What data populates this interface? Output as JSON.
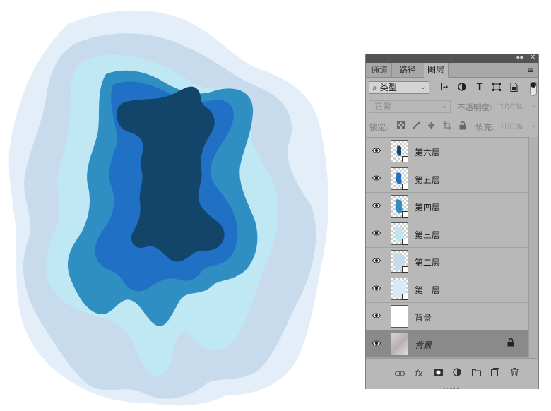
{
  "panel": {
    "collapse_glyph": "◂◂",
    "close_glyph": "✕",
    "tabs": [
      {
        "label": "通道",
        "active": false
      },
      {
        "label": "路径",
        "active": false
      },
      {
        "label": "图层",
        "active": true
      }
    ],
    "menu_glyph": "≡",
    "filter": {
      "label": "类型",
      "icons": [
        "image-filter-icon",
        "adjustment-filter-icon",
        "type-filter-icon",
        "shape-filter-icon",
        "smart-object-filter-icon"
      ]
    },
    "blend_mode": "正常",
    "opacity_label": "不透明度:",
    "opacity_value": "100%",
    "lock_label": "锁定:",
    "fill_label": "填充:",
    "fill_value": "100%",
    "layers": [
      {
        "name": "第六层",
        "thumb_color": "#16456b"
      },
      {
        "name": "第五层",
        "thumb_color": "#1f6fc4"
      },
      {
        "name": "第四层",
        "thumb_color": "#2f8dc0"
      },
      {
        "name": "第三层",
        "thumb_color": "#bfe6f3"
      },
      {
        "name": "第二层",
        "thumb_color": "#c7daea"
      },
      {
        "name": "第一层",
        "thumb_color": "#d9e9f5"
      },
      {
        "name": "背景",
        "thumb_color": "#ffffff"
      },
      {
        "name": "背景",
        "thumb_color": "#c9bcc3",
        "selected": true,
        "locked": true
      }
    ],
    "footer_icons": [
      "link-layers-icon",
      "fx-icon",
      "add-mask-icon",
      "adjustment-layer-icon",
      "group-folder-icon",
      "new-layer-icon",
      "delete-layer-icon"
    ],
    "fx_label": "fx"
  },
  "colors": {
    "layer1": "#e3eef9",
    "layer2": "#c8dbed",
    "layer3": "#bfe7f4",
    "layer4": "#2f8fc2",
    "layer5": "#2070c6",
    "layer6": "#13446a",
    "panel_bg": "#b8b8b8"
  }
}
